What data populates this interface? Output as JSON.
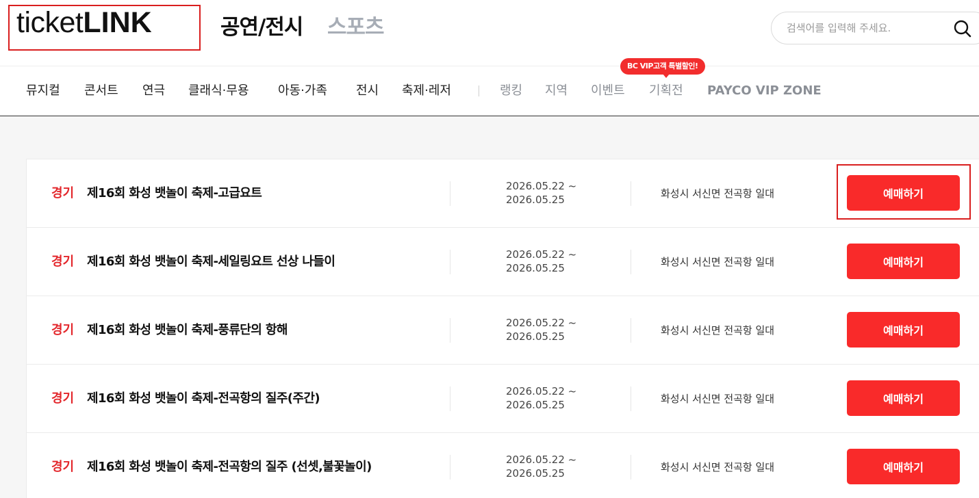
{
  "header": {
    "logo_light": "ticket",
    "logo_bold": "LINK",
    "tabs": [
      "공연/전시",
      "스포츠"
    ],
    "search": {
      "placeholder": "검색어를 입력해 주세요.",
      "icon": "search-icon"
    }
  },
  "nav": {
    "items": [
      "뮤지컬",
      "콘서트",
      "연극",
      "클래식·무용",
      "아동·가족",
      "전시",
      "축제·레저"
    ],
    "sub_items": [
      "랭킹",
      "지역",
      "이벤트",
      "기획전",
      "PAYCO VIP ZONE"
    ],
    "badge": "BC VIP고객 특별할인!"
  },
  "list": {
    "rows": [
      {
        "badge": "경기",
        "title": "제16회 화성 뱃놀이 축제-고급요트",
        "date_start": "2026.05.22 ~",
        "date_end": "2026.05.25",
        "place": "화성시 서신면 전곡항 일대",
        "button": "예매하기"
      },
      {
        "badge": "경기",
        "title": "제16회 화성 뱃놀이 축제-세일링요트 선상 나들이",
        "date_start": "2026.05.22 ~",
        "date_end": "2026.05.25",
        "place": "화성시 서신면 전곡항 일대",
        "button": "예매하기"
      },
      {
        "badge": "경기",
        "title": "제16회 화성 뱃놀이 축제-풍류단의 항해",
        "date_start": "2026.05.22 ~",
        "date_end": "2026.05.25",
        "place": "화성시 서신면 전곡항 일대",
        "button": "예매하기"
      },
      {
        "badge": "경기",
        "title": "제16회 화성 뱃놀이 축제-전곡항의 질주(주간)",
        "date_start": "2026.05.22 ~",
        "date_end": "2026.05.25",
        "place": "화성시 서신면 전곡항 일대",
        "button": "예매하기"
      },
      {
        "badge": "경기",
        "title": "제16회 화성 뱃놀이 축제-전곡항의 질주 (선셋,불꽃놀이)",
        "date_start": "2026.05.22 ~",
        "date_end": "2026.05.25",
        "place": "화성시 서신면 전곡항 일대",
        "button": "예매하기"
      }
    ]
  },
  "colors": {
    "accent": "#f92a2a",
    "badge_text": "#e3262b",
    "inactive_tab": "#a7adb6",
    "sub_nav": "#8b8f96"
  }
}
